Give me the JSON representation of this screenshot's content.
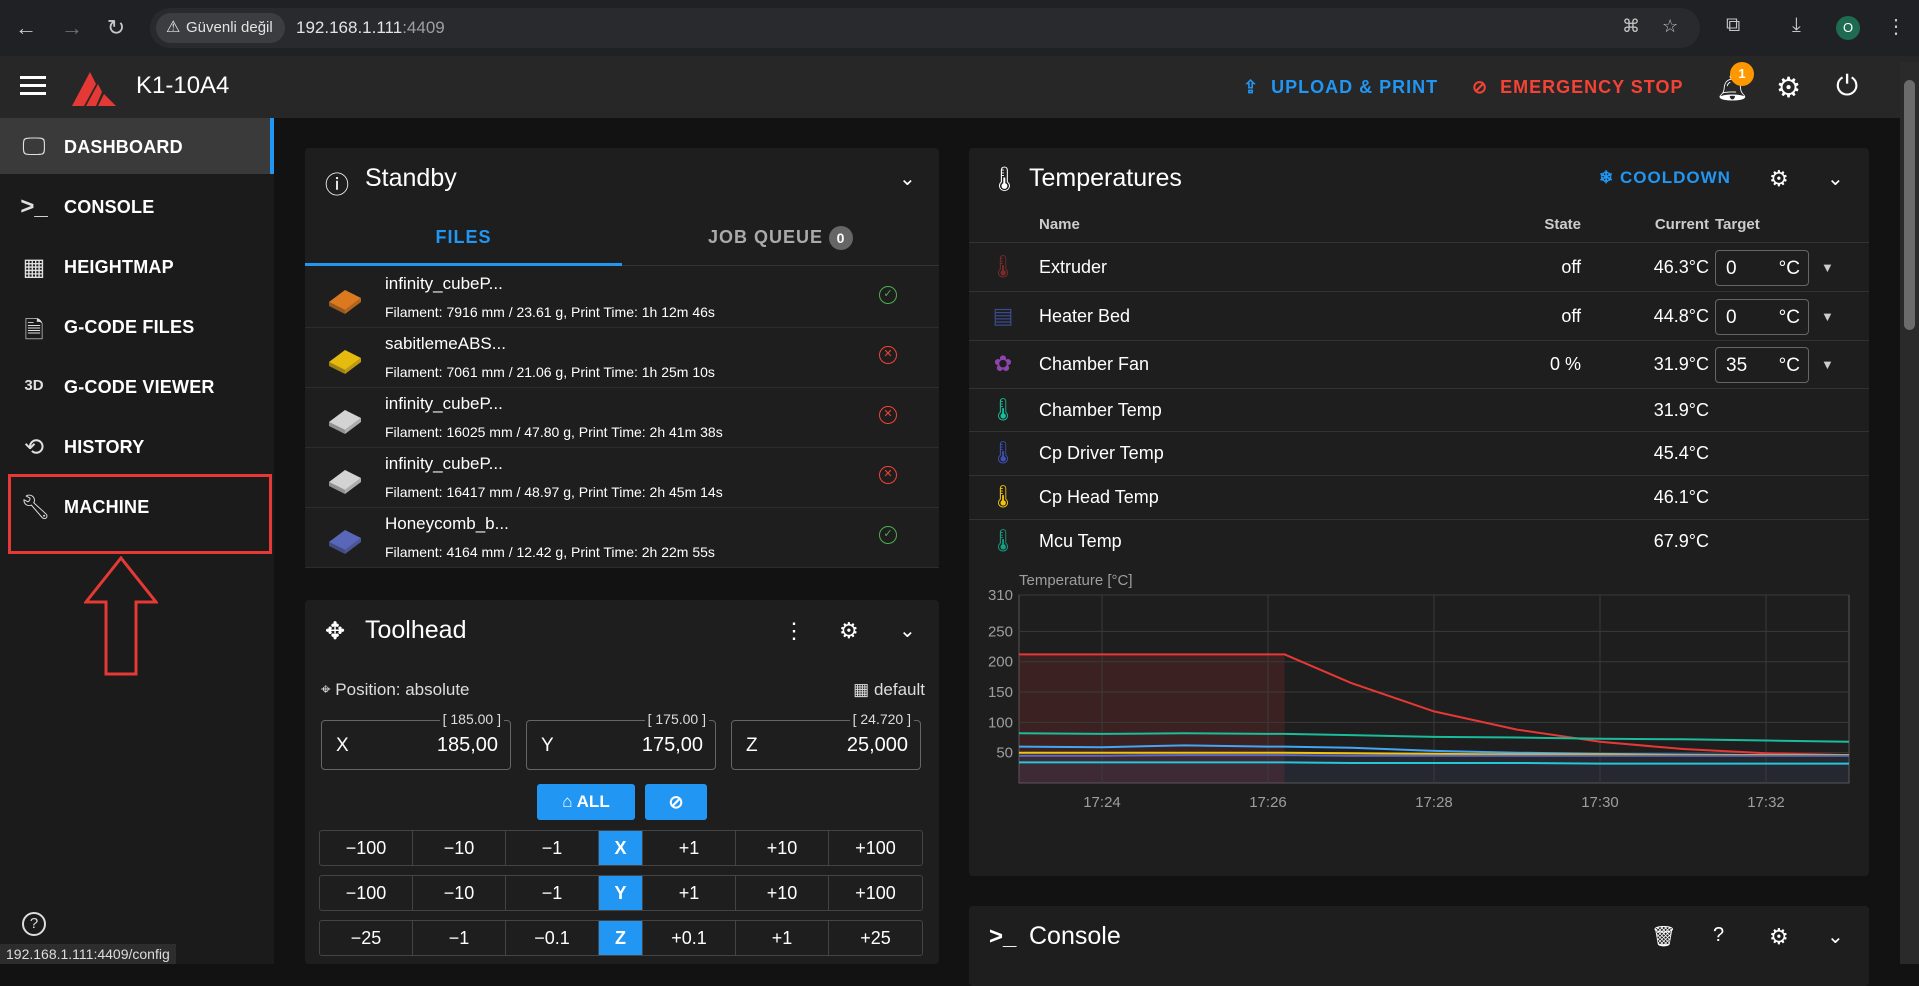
{
  "browser": {
    "security_label": "Güvenli değil",
    "url_host": "192.168.1.111",
    "url_port": ":4409",
    "profile_initial": "O"
  },
  "appbar": {
    "printer_name": "K1-10A4",
    "upload_print": "UPLOAD & PRINT",
    "emergency_stop": "EMERGENCY STOP",
    "notification_count": "1"
  },
  "sidebar": {
    "items": [
      {
        "label": "DASHBOARD",
        "icon": "monitor-dashboard-icon"
      },
      {
        "label": "CONSOLE",
        "icon": "console-icon"
      },
      {
        "label": "HEIGHTMAP",
        "icon": "grid-icon"
      },
      {
        "label": "G-CODE FILES",
        "icon": "file-document-icon"
      },
      {
        "label": "G-CODE VIEWER",
        "icon": "3d-icon"
      },
      {
        "label": "HISTORY",
        "icon": "history-icon"
      },
      {
        "label": "MACHINE",
        "icon": "wrench-icon"
      }
    ],
    "icon_3d": "3D",
    "help": "?",
    "status_url": "192.168.1.111:4409/config"
  },
  "standby": {
    "title": "Standby",
    "tab_files": "FILES",
    "tab_queue": "JOB QUEUE",
    "queue_count": "0",
    "files": [
      {
        "name": "infinity_cubeP...",
        "meta": "Filament: 7916 mm / 23.61 g, Print Time: 1h 12m 46s",
        "status": "ok"
      },
      {
        "name": "sabitlemeABS...",
        "meta": "Filament: 7061 mm / 21.06 g, Print Time: 1h 25m 10s",
        "status": "error"
      },
      {
        "name": "infinity_cubeP...",
        "meta": "Filament: 16025 mm / 47.80 g, Print Time: 2h 41m 38s",
        "status": "error"
      },
      {
        "name": "infinity_cubeP...",
        "meta": "Filament: 16417 mm / 48.97 g, Print Time: 2h 45m 14s",
        "status": "error"
      },
      {
        "name": "Honeycomb_b...",
        "meta": "Filament: 4164 mm / 12.42 g, Print Time: 2h 22m 55s",
        "status": "ok"
      }
    ]
  },
  "toolhead": {
    "title": "Toolhead",
    "position_mode": "Position: absolute",
    "profile": "default",
    "axes": [
      {
        "label": "X",
        "value": "185,00",
        "tag": "[ 185.00 ]"
      },
      {
        "label": "Y",
        "value": "175,00",
        "tag": "[ 175.00 ]"
      },
      {
        "label": "Z",
        "value": "25,000",
        "tag": "[ 24.720 ]"
      }
    ],
    "home_all": "ALL",
    "jog_x": [
      "−100",
      "−10",
      "−1",
      "X",
      "+1",
      "+10",
      "+100"
    ],
    "jog_y": [
      "−100",
      "−10",
      "−1",
      "Y",
      "+1",
      "+10",
      "+100"
    ],
    "jog_z": [
      "−25",
      "−1",
      "−0.1",
      "Z",
      "+0.1",
      "+1",
      "+25"
    ]
  },
  "temperatures": {
    "title": "Temperatures",
    "cooldown": "COOLDOWN",
    "col_name": "Name",
    "col_state": "State",
    "col_current": "Current",
    "col_target": "Target",
    "rows": [
      {
        "name": "Extruder",
        "state": "off",
        "current": "46.3°C",
        "target": "0",
        "unit": "°C",
        "icon_color": "#7b2b2b"
      },
      {
        "name": "Heater Bed",
        "state": "off",
        "current": "44.8°C",
        "target": "0",
        "unit": "°C",
        "icon_color": "#3b4a8c"
      },
      {
        "name": "Chamber Fan",
        "state": "0 %",
        "current": "31.9°C",
        "target": "35",
        "unit": "°C",
        "icon_color": "#8e44ad"
      },
      {
        "name": "Chamber Temp",
        "current": "31.9°C",
        "icon_color": "#1abc9c"
      },
      {
        "name": "Cp Driver Temp",
        "current": "45.4°C",
        "icon_color": "#3f51b5"
      },
      {
        "name": "Cp Head Temp",
        "current": "46.1°C",
        "icon_color": "#f1c40f"
      },
      {
        "name": "Mcu Temp",
        "current": "67.9°C",
        "icon_color": "#16a085"
      }
    ]
  },
  "console": {
    "title": "Console"
  },
  "chart_data": {
    "type": "line",
    "title": "",
    "ylabel": "Temperature [°C]",
    "xlabel": "",
    "ylim": [
      0,
      310
    ],
    "yticks": [
      310,
      250,
      200,
      150,
      100,
      50
    ],
    "xticks": [
      "17:24",
      "17:26",
      "17:28",
      "17:30",
      "17:32"
    ],
    "x": [
      "17:23",
      "17:24",
      "17:25",
      "17:26",
      "17:26.2",
      "17:27",
      "17:28",
      "17:29",
      "17:30",
      "17:31",
      "17:32",
      "17:33"
    ],
    "grid": true,
    "series": [
      {
        "color": "#e53935",
        "values": [
          212,
          212,
          212,
          212,
          212,
          165,
          118,
          88,
          68,
          56,
          49,
          46
        ]
      },
      {
        "color": "#1abc9c",
        "values": [
          82,
          81,
          82,
          81,
          81,
          79,
          76,
          75,
          73,
          72,
          70,
          68
        ]
      },
      {
        "color": "#42a5f5",
        "values": [
          60,
          59,
          62,
          60,
          60,
          58,
          53,
          50,
          48,
          47,
          46,
          46
        ]
      },
      {
        "color": "#f1c40f",
        "values": [
          50,
          50,
          50,
          50,
          50,
          49,
          48,
          47,
          47,
          46,
          46,
          46
        ]
      },
      {
        "color": "#26c6da",
        "values": [
          34,
          34,
          34,
          34,
          34,
          33,
          33,
          33,
          32,
          32,
          32,
          32
        ]
      },
      {
        "color": "#5c6bc0",
        "values": [
          45,
          45,
          46,
          46,
          46,
          45,
          45,
          45,
          45,
          45,
          45,
          45
        ]
      }
    ]
  }
}
